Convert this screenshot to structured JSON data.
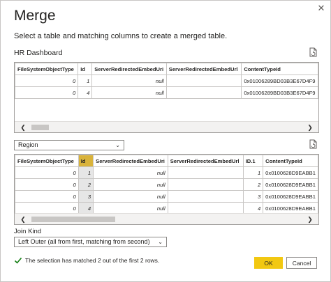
{
  "dialog": {
    "title": "Merge",
    "subtitle": "Select a table and matching columns to create a merged table.",
    "close_glyph": "✕"
  },
  "top_table": {
    "name": "HR Dashboard",
    "columns": [
      "FileSystemObjectType",
      "Id",
      "ServerRedirectedEmbedUri",
      "ServerRedirectedEmbedUrl",
      "ContentTypeId"
    ],
    "rows": [
      [
        "0",
        "1",
        "null",
        "",
        "0x01006289BD03B3E67D4F9"
      ],
      [
        "0",
        "4",
        "null",
        "",
        "0x01006289BD03B3E67D4F9"
      ]
    ]
  },
  "bottom_table": {
    "selected_table": "Region",
    "columns": [
      "FileSystemObjectType",
      "Id",
      "ServerRedirectedEmbedUri",
      "ServerRedirectedEmbedUrl",
      "ID.1",
      "ContentTypeId"
    ],
    "rows": [
      [
        "0",
        "1",
        "null",
        "",
        "1",
        "0x0100628D9EABB1"
      ],
      [
        "0",
        "2",
        "null",
        "",
        "2",
        "0x0100628D9EABB1"
      ],
      [
        "0",
        "3",
        "null",
        "",
        "3",
        "0x0100628D9EABB1"
      ],
      [
        "0",
        "4",
        "null",
        "",
        "4",
        "0x0100628D9EABB1"
      ]
    ]
  },
  "join": {
    "label": "Join Kind",
    "value": "Left Outer (all from first, matching from second)"
  },
  "status": {
    "message": "The selection has matched 2 out of the first 2 rows."
  },
  "buttons": {
    "ok": "OK",
    "cancel": "Cancel"
  },
  "scroll_glyphs": {
    "left": "❮",
    "right": "❯"
  },
  "dropdown_chevron": "⌄",
  "colors": {
    "accent": "#f2c811",
    "selected_header": "#d9b33b",
    "success": "#107c10"
  },
  "icons": {
    "refresh": "refresh-icon",
    "check": "checkmark-icon",
    "close": "close-icon"
  }
}
